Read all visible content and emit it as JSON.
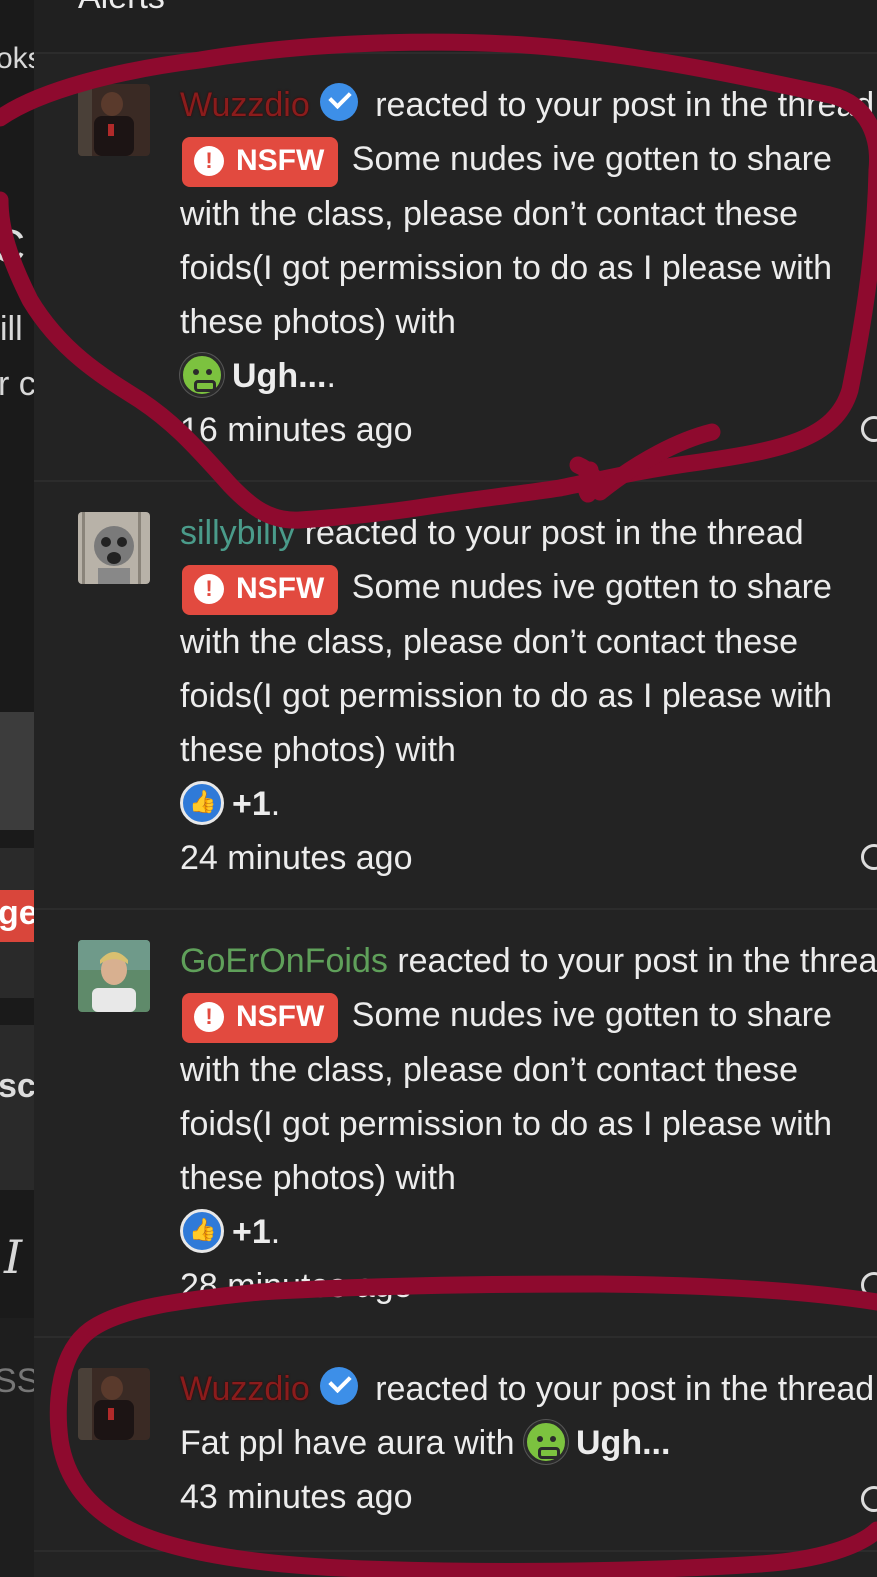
{
  "panel": {
    "title": "Alerts"
  },
  "background_fragments": [
    "oks",
    "ill",
    "r c",
    "ge",
    "sc",
    "I",
    "SS"
  ],
  "alerts": [
    {
      "user": "Wuzzdio",
      "verified": true,
      "action": "reacted to your post in the thread",
      "badge": "NSFW",
      "thread": "Some nudes ive gotten to share with the class, please don’t contact these foids(I got permission to do as I please with these photos)",
      "with_text": "with",
      "reaction": "Ugh...",
      "reaction_icon": "sick-face-icon",
      "time": "16 minutes ago"
    },
    {
      "user": "sillybilly",
      "verified": false,
      "action": "reacted to your post in the thread",
      "badge": "NSFW",
      "thread": "Some nudes ive gotten to share with the class, please don’t contact these foids(I got permission to do as I please with these photos)",
      "with_text": "with",
      "reaction": "+1",
      "reaction_icon": "thumbs-up-icon",
      "time": "24 minutes ago"
    },
    {
      "user": "GoErOnFoids",
      "verified": false,
      "action": "reacted to your post in the thread",
      "badge": "NSFW",
      "thread": "Some nudes ive gotten to share with the class, please don’t contact these foids(I got permission to do as I please with these photos)",
      "with_text": "with",
      "reaction": "+1",
      "reaction_icon": "thumbs-up-icon",
      "time": "28 minutes ago"
    },
    {
      "user": "Wuzzdio",
      "verified": true,
      "action": "reacted to your post in the thread",
      "thread": "Fat ppl have aura",
      "with_text": "with",
      "reaction": "Ugh...",
      "reaction_icon": "sick-face-icon",
      "time": "43 minutes ago"
    }
  ],
  "colors": {
    "scribble": "#8e0a2e",
    "nsfw_badge": "#e24a3f",
    "verified": "#3d8fe8"
  }
}
